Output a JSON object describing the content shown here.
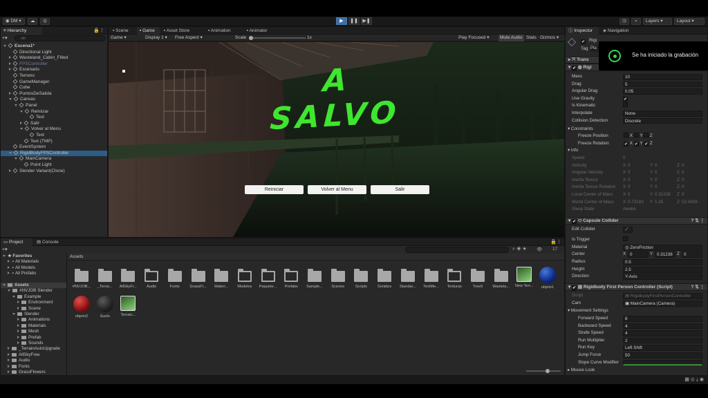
{
  "toolbar": {
    "account": "DM",
    "layers": "Layers",
    "layout": "Layout"
  },
  "hierarchy": {
    "tab": "Hierarchy",
    "search_placeholder": "All",
    "items": [
      {
        "label": "Escena1*",
        "depth": 0,
        "open": true,
        "arrow": true,
        "bold": true
      },
      {
        "label": "Directional Light",
        "depth": 1
      },
      {
        "label": "Wasteland_Cabin_Filled",
        "depth": 1,
        "arrow": true
      },
      {
        "label": "FPSController",
        "depth": 1,
        "arrow": true,
        "dim": true
      },
      {
        "label": "Escenario",
        "depth": 1,
        "arrow": true
      },
      {
        "label": "Terreno",
        "depth": 1
      },
      {
        "label": "GameManager",
        "depth": 1
      },
      {
        "label": "Cube",
        "depth": 1
      },
      {
        "label": "PuntosDeSalida",
        "depth": 1,
        "arrow": true
      },
      {
        "label": "Canvas",
        "depth": 1,
        "arrow": true,
        "open": true
      },
      {
        "label": "Panel",
        "depth": 2,
        "arrow": true,
        "open": true
      },
      {
        "label": "Reiniciar",
        "depth": 3,
        "arrow": true,
        "open": true
      },
      {
        "label": "Text",
        "depth": 4
      },
      {
        "label": "Salir",
        "depth": 3,
        "arrow": true
      },
      {
        "label": "Volver al Menu",
        "depth": 3,
        "arrow": true,
        "open": true
      },
      {
        "label": "Text",
        "depth": 4
      },
      {
        "label": "Text (TMP)",
        "depth": 3
      },
      {
        "label": "EventSystem",
        "depth": 1
      },
      {
        "label": "RigidBodyFPSController",
        "depth": 1,
        "arrow": true,
        "open": true,
        "selected": true
      },
      {
        "label": "MainCamera",
        "depth": 2,
        "arrow": true,
        "open": true
      },
      {
        "label": "Point Light",
        "depth": 3
      },
      {
        "label": "Slender Variant(Clone)",
        "depth": 1,
        "arrow": true
      }
    ]
  },
  "view_tabs": [
    "Scene",
    "Game",
    "Asset Store",
    "Animation",
    "Animator"
  ],
  "game_bar": {
    "mode": "Game",
    "display": "Display 1",
    "aspect": "Free Aspect",
    "scale_label": "Scale",
    "scale_value": "1x",
    "play_focused": "Play Focused",
    "mute": "Mute Audio",
    "stats": "Stats",
    "gizmos": "Gizmos"
  },
  "game": {
    "title": "A SALVO",
    "buttons": [
      "Reiniciar",
      "Volver al Menu",
      "Salir"
    ]
  },
  "inspector": {
    "tabs": [
      "Inspector",
      "Navigation"
    ],
    "object_name": "Rigi",
    "tag_label": "Tag",
    "tag_value": "Pla",
    "transform": "Trans",
    "rigidbody": "Rigi",
    "rows": [
      {
        "label": "Mass",
        "value": "10"
      },
      {
        "label": "Drag",
        "value": "5"
      },
      {
        "label": "Angular Drag",
        "value": "0.05"
      },
      {
        "label": "Use Gravity",
        "value": "✔"
      },
      {
        "label": "Is Kinematic",
        "value": ""
      },
      {
        "label": "Interpolate",
        "value": "None"
      },
      {
        "label": "Collision Detection",
        "value": "Discrete"
      }
    ],
    "constraints": "Constraints",
    "freeze_position": "Freeze Position",
    "freeze_rotation": "Freeze Rotation",
    "info": "Info",
    "info_rows": [
      {
        "label": "Speed",
        "value": "0"
      },
      {
        "label": "Velocity",
        "x": "0",
        "y": "0",
        "z": "0"
      },
      {
        "label": "Angular Velocity",
        "x": "0",
        "y": "0",
        "z": "0"
      },
      {
        "label": "Inertia Tensor",
        "x": "0",
        "y": "0",
        "z": "0"
      },
      {
        "label": "Inertia Tensor Rotation",
        "x": "0",
        "y": "0",
        "z": "0"
      },
      {
        "label": "Local Center of Mass",
        "x": "0",
        "y": "0.31238",
        "z": "0"
      },
      {
        "label": "World Center of Mass",
        "x": "0.73183",
        "y": "1.25",
        "z": "52.4309"
      },
      {
        "label": "Sleep State",
        "value": "Awake"
      }
    ],
    "capsule": {
      "title": "Capsule Collider",
      "edit": "Edit Collider",
      "is_trigger": "Is Trigger",
      "material_label": "Material",
      "material": "ZeroFriction",
      "center_label": "Center",
      "cx": "0",
      "cy": "0.31238",
      "cz": "0",
      "radius_label": "Radius",
      "radius": "0.5",
      "height_label": "Height",
      "height": "2.5",
      "direction_label": "Direction",
      "direction": "Y-Axis"
    },
    "rbfpc": {
      "title": "Rigidbody First Person Controller (Script)",
      "script_label": "Script",
      "script": "RigidbodyFirstPersonController",
      "cam_label": "Cam",
      "cam": "MainCamera (Camera)",
      "movement": "Movement Settings",
      "rows": [
        {
          "label": "Forward Speed",
          "value": "8"
        },
        {
          "label": "Backward Speed",
          "value": "4"
        },
        {
          "label": "Strafe Speed",
          "value": "4"
        },
        {
          "label": "Run Multiplier",
          "value": "2"
        },
        {
          "label": "Run Key",
          "value": "Left Shift"
        },
        {
          "label": "Jump Force",
          "value": "50"
        },
        {
          "label": "Slope Curve Modifier",
          "value": ""
        }
      ],
      "mouse_look": "Mouse Look"
    }
  },
  "notification": "Se ha iniciado la grabación",
  "project": {
    "tabs": [
      "Project",
      "Console"
    ],
    "assets_header": "Assets",
    "count": "17",
    "tree": [
      {
        "label": "Favorites",
        "depth": 0,
        "bold": true,
        "open": true
      },
      {
        "label": "All Materials",
        "depth": 1,
        "search": true
      },
      {
        "label": "All Models",
        "depth": 1,
        "search": true
      },
      {
        "label": "All Prefabs",
        "depth": 1,
        "search": true
      },
      {
        "label": "",
        "depth": 0
      },
      {
        "label": "Assets",
        "depth": 0,
        "bold": true,
        "open": true,
        "folder": true
      },
      {
        "label": "#NVJOB Slender",
        "depth": 1,
        "open": true,
        "folder": true
      },
      {
        "label": "Example",
        "depth": 2,
        "open": true,
        "folder": true
      },
      {
        "label": "Environment",
        "depth": 3,
        "folder": true
      },
      {
        "label": "Scene",
        "depth": 3,
        "folder": true
      },
      {
        "label": "Slender",
        "depth": 2,
        "open": true,
        "folder": true
      },
      {
        "label": "Animations",
        "depth": 3,
        "folder": true
      },
      {
        "label": "Materials",
        "depth": 3,
        "folder": true
      },
      {
        "label": "Mesh",
        "depth": 3,
        "folder": true
      },
      {
        "label": "Prefab",
        "depth": 3,
        "folder": true
      },
      {
        "label": "Sounds",
        "depth": 3,
        "folder": true
      },
      {
        "label": "_TerrainAutoUpgrade",
        "depth": 1,
        "folder": true
      },
      {
        "label": "AllSkyFree",
        "depth": 1,
        "folder": true
      },
      {
        "label": "Audio",
        "depth": 1,
        "folder": true
      },
      {
        "label": "Fonts",
        "depth": 1,
        "folder": true
      },
      {
        "label": "GrassFlowers",
        "depth": 1,
        "folder": true
      }
    ],
    "assets": [
      {
        "label": "#NVJOB...",
        "kind": "folder"
      },
      {
        "label": "_Terrai...",
        "kind": "folder"
      },
      {
        "label": "AllSkyFr...",
        "kind": "folder"
      },
      {
        "label": "Audio",
        "kind": "empty"
      },
      {
        "label": "Fonts",
        "kind": "folder"
      },
      {
        "label": "GrassFl...",
        "kind": "folder"
      },
      {
        "label": "Materi...",
        "kind": "folder"
      },
      {
        "label": "Modelos",
        "kind": "empty"
      },
      {
        "label": "Paquete...",
        "kind": "empty"
      },
      {
        "label": "Prefabs",
        "kind": "empty"
      },
      {
        "label": "Sample...",
        "kind": "folder"
      },
      {
        "label": "Scenes",
        "kind": "folder"
      },
      {
        "label": "Scripts",
        "kind": "folder"
      },
      {
        "label": "Sonidos",
        "kind": "folder"
      },
      {
        "label": "Standar...",
        "kind": "folder"
      },
      {
        "label": "TextMe...",
        "kind": "folder"
      },
      {
        "label": "Texturas",
        "kind": "empty"
      },
      {
        "label": "Tree9",
        "kind": "folder"
      },
      {
        "label": "Wastela...",
        "kind": "folder"
      },
      {
        "label": "New Terr...",
        "kind": "terrain"
      },
      {
        "label": "objeto1",
        "kind": "blue"
      },
      {
        "label": "objeto2",
        "kind": "red"
      },
      {
        "label": "Suelo",
        "kind": "black"
      },
      {
        "label": "Terrain...",
        "kind": "terrain"
      }
    ]
  },
  "colors": {
    "accent": "#3d6ea6",
    "title_green": "#3fe62f",
    "selected": "#2c5d87"
  }
}
